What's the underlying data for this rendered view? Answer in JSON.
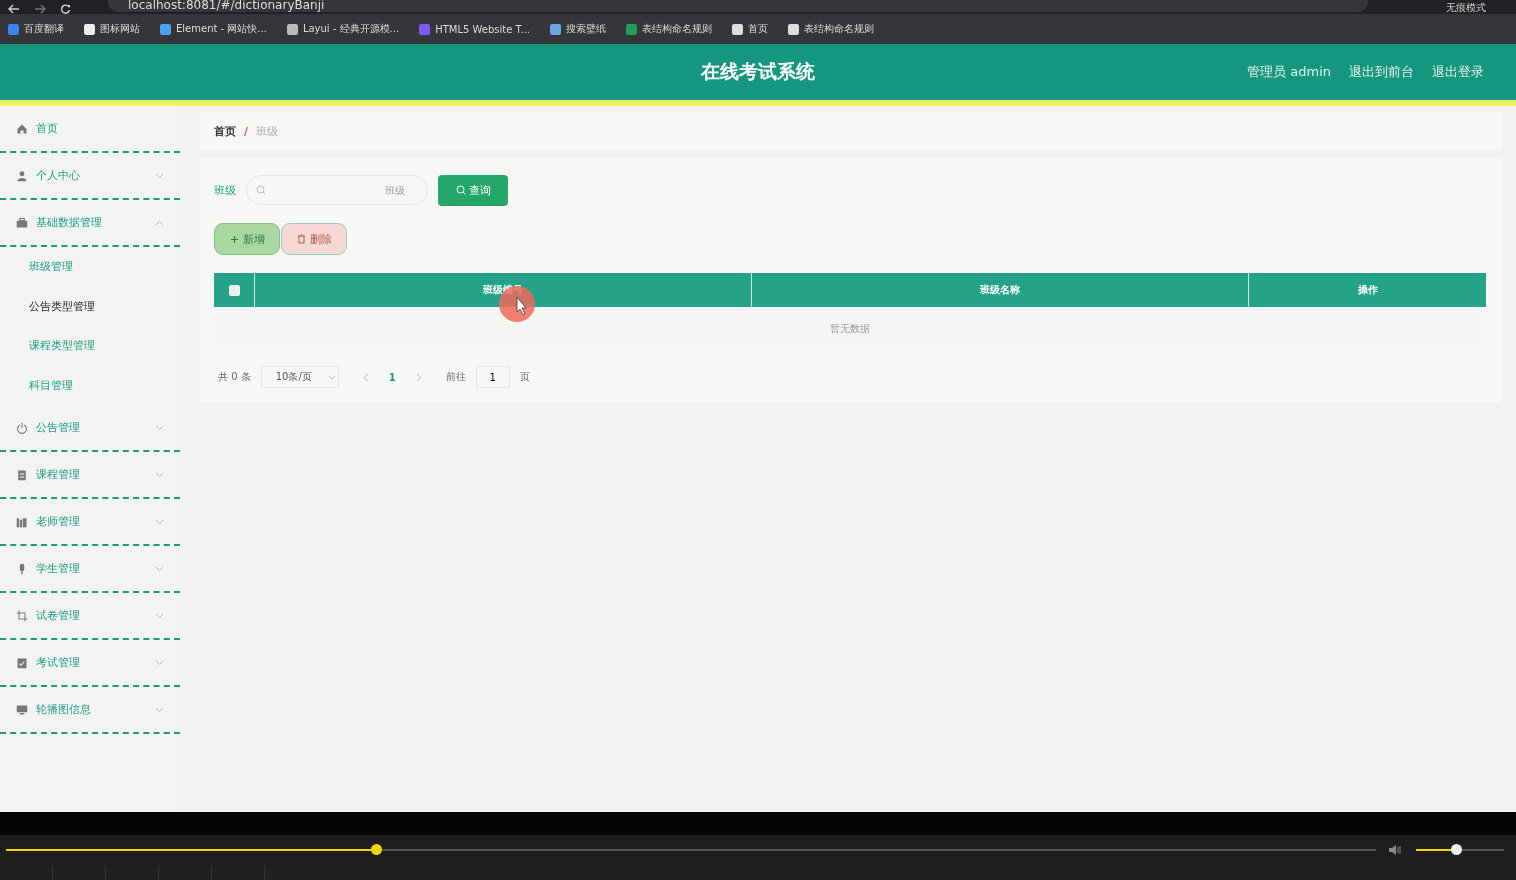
{
  "browser": {
    "url": "localhost:8081/#/dictionaryBanji",
    "profile_label": "无痕模式",
    "bookmarks": [
      "百度翻译",
      "图标网站",
      "Element - 网站快...",
      "Layui - 经典开源模...",
      "HTML5 Website T...",
      "搜索壁纸",
      "表结构命名规则",
      "首页",
      "表结构命名规则"
    ]
  },
  "header": {
    "title": "在线考试系统",
    "links": [
      "管理员 admin",
      "退出到前台",
      "退出登录"
    ]
  },
  "sidebar": {
    "items": [
      {
        "label": "首页"
      },
      {
        "label": "个人中心",
        "expanded": false
      },
      {
        "label": "基础数据管理",
        "expanded": true,
        "children": [
          {
            "label": "班级管理",
            "selected": false
          },
          {
            "label": "公告类型管理",
            "selected": true
          },
          {
            "label": "课程类型管理",
            "selected": false
          },
          {
            "label": "科目管理",
            "selected": false
          }
        ]
      },
      {
        "label": "公告管理",
        "expanded": false
      },
      {
        "label": "课程管理",
        "expanded": false
      },
      {
        "label": "老师管理",
        "expanded": false
      },
      {
        "label": "学生管理",
        "expanded": false
      },
      {
        "label": "试卷管理",
        "expanded": false
      },
      {
        "label": "考试管理",
        "expanded": false
      },
      {
        "label": "轮播图信息",
        "expanded": false
      }
    ]
  },
  "breadcrumb": {
    "items": [
      "首页",
      "班级"
    ],
    "separator": "/"
  },
  "search": {
    "label": "班级",
    "placeholder": "班级",
    "button": "查询"
  },
  "actions": [
    {
      "kind": "add",
      "label": "新增"
    },
    {
      "kind": "delete",
      "label": "删除"
    }
  ],
  "table": {
    "select_all": {
      "checked": false
    },
    "columns": [
      "班级编号",
      "班级名称",
      "操作"
    ],
    "empty_text": "暂无数据"
  },
  "pagination": {
    "total": "共 0 条",
    "page_size": "10条/页",
    "pages": [
      {
        "label": "1",
        "selected": true
      }
    ],
    "goto_label": "前往",
    "goto_value": "1",
    "page_suffix": "页"
  },
  "player": {
    "progress": {
      "level": 0.27
    },
    "volume": {
      "level": 0.45
    }
  }
}
